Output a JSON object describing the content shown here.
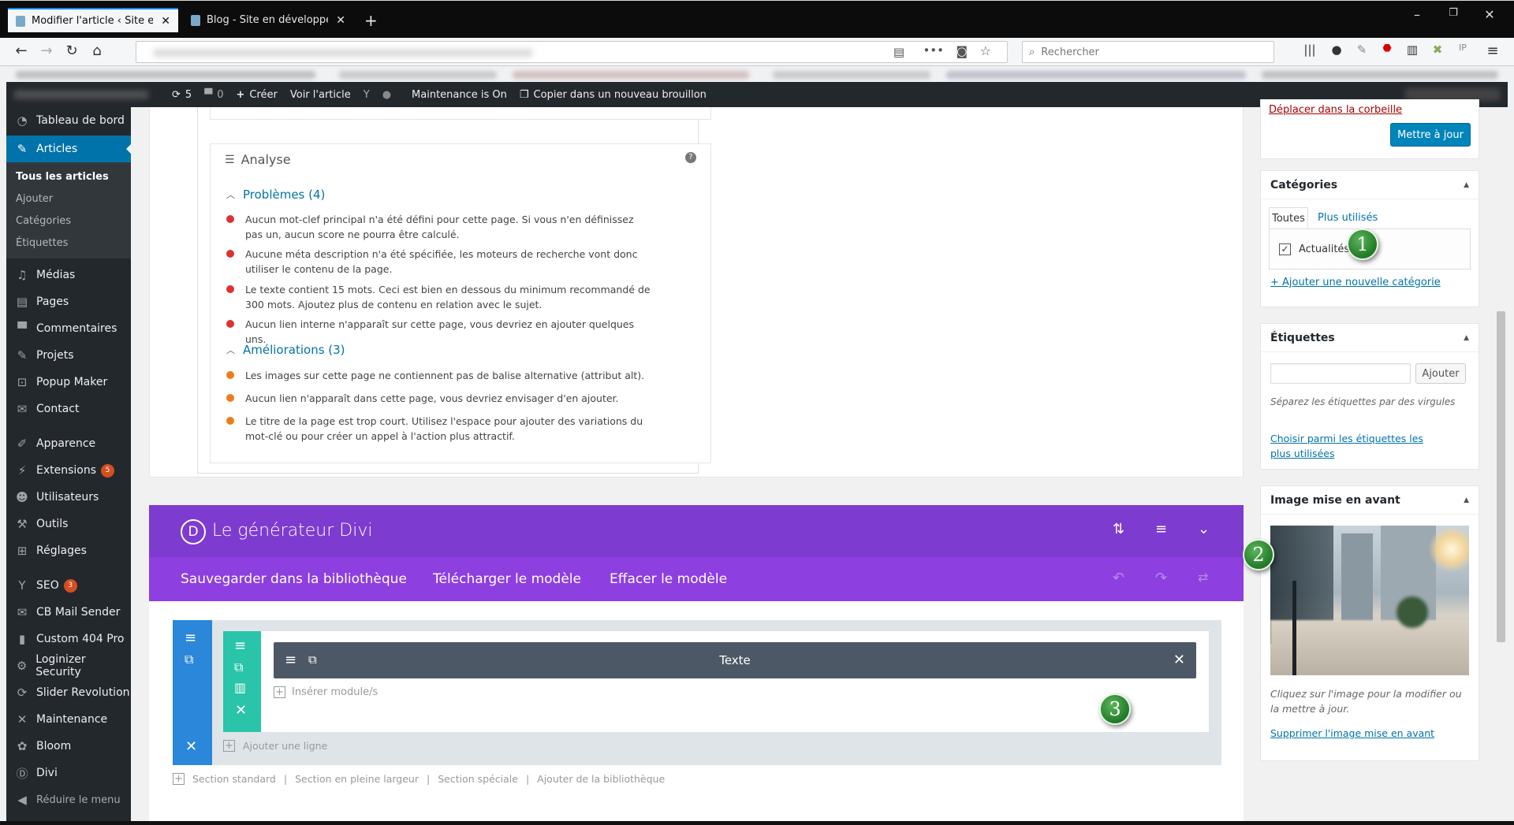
{
  "browser": {
    "tabs": [
      {
        "title": "Modifier l'article ‹ Site en dével",
        "active": true
      },
      {
        "title": "Blog - Site en développement",
        "active": false
      }
    ],
    "new_tab": "+",
    "close": "✕",
    "search_placeholder": "Rechercher"
  },
  "admin_bar": {
    "updates_count": "5",
    "comments_count": "0",
    "create": "Créer",
    "view_post": "Voir l'article",
    "maintenance": "Maintenance is On",
    "copy_draft": "Copier dans un nouveau brouillon"
  },
  "sidebar": {
    "items": [
      {
        "label": "Tableau de bord",
        "icon": "dashboard-icon"
      },
      {
        "label": "Articles",
        "icon": "pin-icon",
        "active": true
      },
      {
        "label": "Médias",
        "icon": "media-icon"
      },
      {
        "label": "Pages",
        "icon": "pages-icon"
      },
      {
        "label": "Commentaires",
        "icon": "comment-icon"
      },
      {
        "label": "Projets",
        "icon": "pin-icon"
      },
      {
        "label": "Popup Maker",
        "icon": "popup-icon"
      },
      {
        "label": "Contact",
        "icon": "mail-icon"
      },
      {
        "label": "Apparence",
        "icon": "brush-icon"
      },
      {
        "label": "Extensions",
        "icon": "plugin-icon",
        "badge": "5"
      },
      {
        "label": "Utilisateurs",
        "icon": "user-icon"
      },
      {
        "label": "Outils",
        "icon": "wrench-icon"
      },
      {
        "label": "Réglages",
        "icon": "settings-icon"
      },
      {
        "label": "SEO",
        "icon": "seo-icon",
        "badge": "3"
      },
      {
        "label": "CB Mail Sender",
        "icon": "mail-icon"
      },
      {
        "label": "Custom 404 Pro",
        "icon": "chart-icon"
      },
      {
        "label": "Loginizer Security",
        "icon": "gear-icon"
      },
      {
        "label": "Slider Revolution",
        "icon": "refresh-icon"
      },
      {
        "label": "Maintenance",
        "icon": "tools-icon"
      },
      {
        "label": "Bloom",
        "icon": "bloom-icon"
      },
      {
        "label": "Divi",
        "icon": "divi-icon"
      },
      {
        "label": "Réduire le menu",
        "icon": "collapse-icon"
      }
    ],
    "submenu": [
      "Tous les articles",
      "Ajouter",
      "Catégories",
      "Étiquettes"
    ]
  },
  "analysis": {
    "title": "Analyse",
    "problems_title": "Problèmes (4)",
    "problems": [
      "Aucun mot-clef principal n'a été défini pour cette page. Si vous n'en définissez pas un, aucun score ne pourra être calculé.",
      "Aucune méta description n'a été spécifiée, les moteurs de recherche vont donc utiliser le contenu de la page.",
      "Le texte contient 15 mots. Ceci est bien en dessous du minimum recommandé de 300 mots. Ajoutez plus de contenu en relation avec le sujet.",
      "Aucun lien interne n'apparaît sur cette page, vous devriez en ajouter quelques uns."
    ],
    "improvements_title": "Améliorations (3)",
    "improvements": [
      "Les images sur cette page ne contiennent pas de balise alternative (attribut alt).",
      "Aucun lien n'apparaît dans cette page, vous devriez envisager d'en ajouter.",
      "Le titre de la page est trop court. Utilisez l'espace pour ajouter des variations du mot-clé ou pour créer un appel à l'action plus attractif."
    ],
    "colors": {
      "problem": "#dc3232",
      "improvement": "#ee7c1b"
    }
  },
  "publish": {
    "trash": "Déplacer dans la corbeille",
    "update": "Mettre à jour"
  },
  "categories": {
    "title": "Catégories",
    "tab_all": "Toutes",
    "tab_used": "Plus utilisés",
    "item": "Actualités",
    "checked": true,
    "add_new": "+ Ajouter une nouvelle catégorie"
  },
  "tags": {
    "title": "Étiquettes",
    "input_value": "",
    "add": "Ajouter",
    "hint": "Séparez les étiquettes par des virgules",
    "choose": "Choisir parmi les étiquettes les plus utilisées"
  },
  "featured_image": {
    "title": "Image mise en avant",
    "hint": "Cliquez sur l'image pour la modifier ou la mettre à jour.",
    "remove": "Supprimer l'image mise en avant"
  },
  "divi": {
    "title": "Le générateur Divi",
    "logo_letter": "D",
    "save_library": "Sauvegarder dans la bibliothèque",
    "load_template": "Télécharger le modèle",
    "clear_template": "Effacer le modèle",
    "module_title": "Texte",
    "insert_module": "Insérer module/s",
    "add_row": "Ajouter une ligne",
    "add_sections": [
      "Section standard",
      "Section en pleine largeur",
      "Section spéciale",
      "Ajouter de la bibliothèque"
    ],
    "separator": "|",
    "colors": {
      "header": "#7e3bd0",
      "subheader": "#8d3fe0",
      "section": "#2b87da",
      "row": "#29c4a9",
      "module": "#4c5866"
    }
  },
  "callouts": [
    "1",
    "2",
    "3"
  ]
}
